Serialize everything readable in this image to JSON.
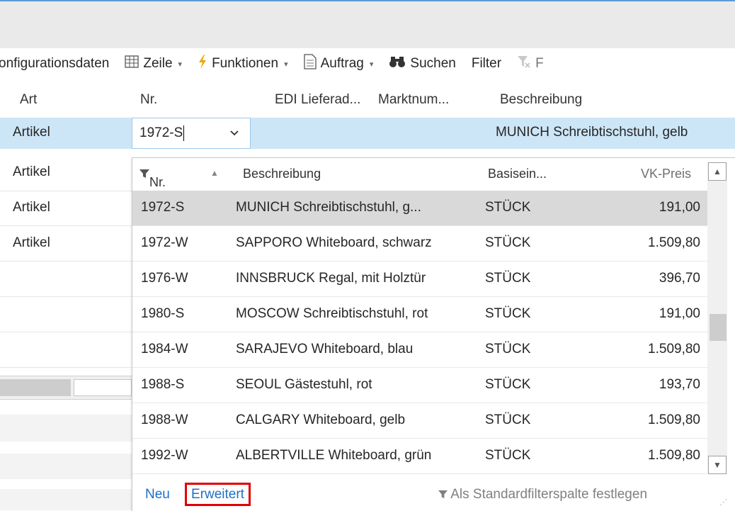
{
  "toolbar": {
    "items": [
      {
        "label": "onfigurationsdaten",
        "icon": ""
      },
      {
        "label": "Zeile",
        "icon": "grid-icon",
        "caret": "▾"
      },
      {
        "label": "Funktionen",
        "icon": "lightning-icon",
        "caret": "▾"
      },
      {
        "label": "Auftrag",
        "icon": "document-icon",
        "caret": "▾"
      },
      {
        "label": "Suchen",
        "icon": "binoculars-icon"
      },
      {
        "label": "Filter",
        "icon": ""
      },
      {
        "label": "F",
        "icon": "clear-filter-icon"
      }
    ]
  },
  "grid": {
    "headers": {
      "art": "Art",
      "nr": "Nr.",
      "edi": "EDI Lieferad...",
      "markt": "Marktnum...",
      "beschreibung": "Beschreibung"
    },
    "current_row": {
      "art": "Artikel",
      "nr": "1972-S",
      "beschreibung": "MUNICH Schreibtischstuhl, gelb"
    },
    "other_rows": [
      "Artikel",
      "Artikel",
      "Artikel"
    ]
  },
  "lookup": {
    "headers": {
      "nr": "Nr.",
      "beschreibung": "Beschreibung",
      "basis": "Basisein...",
      "vk": "VK-Preis"
    },
    "rows": [
      {
        "nr": "1972-S",
        "desc": "MUNICH Schreibtischstuhl, g...",
        "unit": "STÜCK",
        "price": "191,00"
      },
      {
        "nr": "1972-W",
        "desc": "SAPPORO Whiteboard, schwarz",
        "unit": "STÜCK",
        "price": "1.509,80"
      },
      {
        "nr": "1976-W",
        "desc": "INNSBRUCK Regal, mit Holztür",
        "unit": "STÜCK",
        "price": "396,70"
      },
      {
        "nr": "1980-S",
        "desc": "MOSCOW Schreibtischstuhl, rot",
        "unit": "STÜCK",
        "price": "191,00"
      },
      {
        "nr": "1984-W",
        "desc": "SARAJEVO Whiteboard, blau",
        "unit": "STÜCK",
        "price": "1.509,80"
      },
      {
        "nr": "1988-S",
        "desc": "SEOUL Gästestuhl, rot",
        "unit": "STÜCK",
        "price": "193,70"
      },
      {
        "nr": "1988-W",
        "desc": "CALGARY Whiteboard, gelb",
        "unit": "STÜCK",
        "price": "1.509,80"
      },
      {
        "nr": "1992-W",
        "desc": "ALBERTVILLE Whiteboard, grün",
        "unit": "STÜCK",
        "price": "1.509,80"
      }
    ],
    "footer": {
      "neu": "Neu",
      "erweitert": "Erweitert",
      "standard": "Als Standardfilterspalte festlegen"
    }
  },
  "colors": {
    "selection": "#cde6f7",
    "link": "#1f6fc5",
    "highlight_border": "#e00000",
    "row_selected": "#d9d9d9"
  }
}
